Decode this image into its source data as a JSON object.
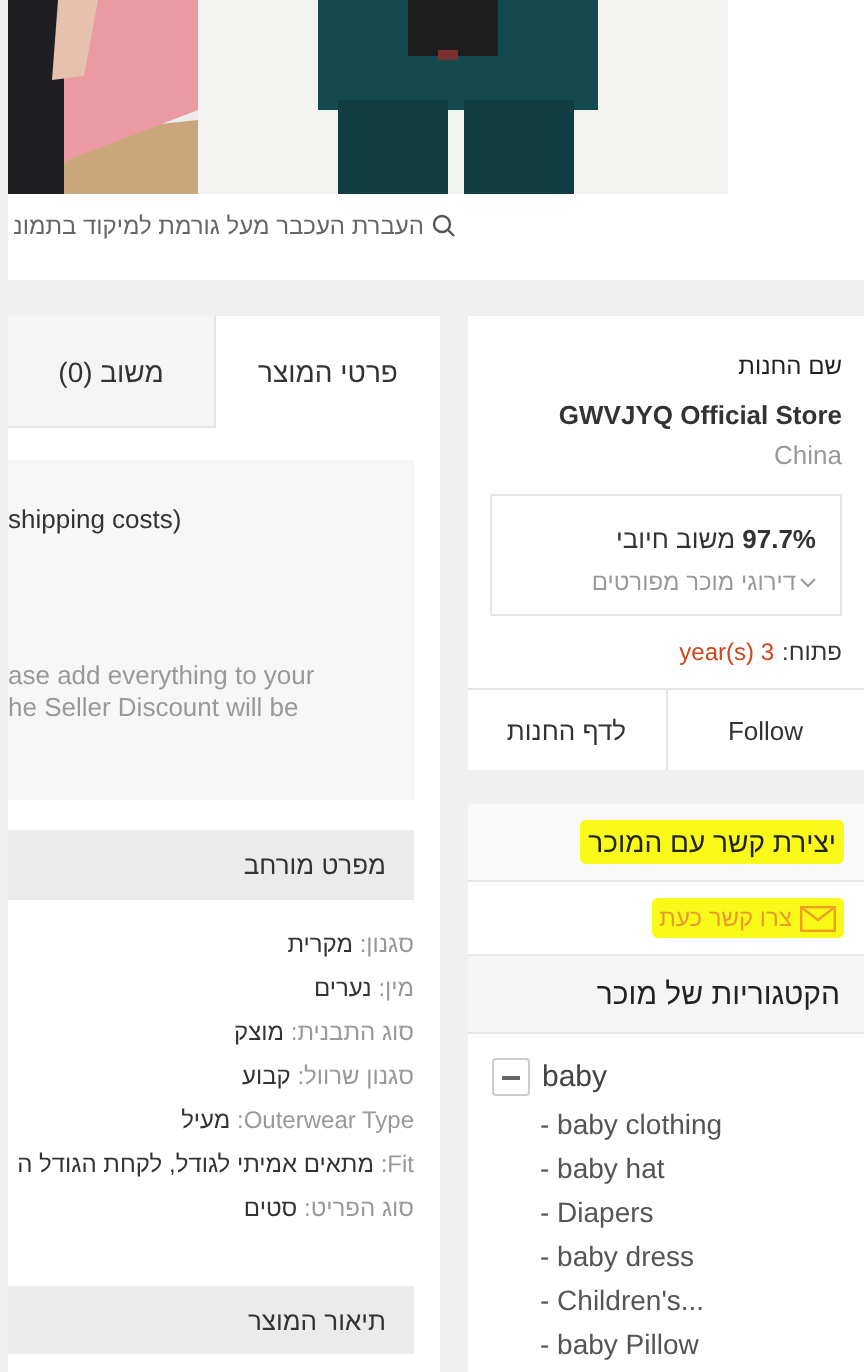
{
  "zoom_hint": "העברת העכבר מעל גורמת למיקוד בתמונ",
  "tabs": [
    {
      "label": "פרטי המוצר",
      "selected": true
    },
    {
      "label": "משוב (0)",
      "selected": false
    }
  ],
  "notice": [
    "shipping costs)",
    "ase add everything to your",
    "he Seller Discount will be"
  ],
  "specs": {
    "title": "מפרט מורחב",
    "rows": [
      {
        "label": "סגנון:",
        "value": "מקרית"
      },
      {
        "label": "מין:",
        "value": "נערים"
      },
      {
        "label": "סוג התבנית:",
        "value": "מוצק"
      },
      {
        "label": "סגנון שרוול:",
        "value": "קבוע"
      },
      {
        "label": "Outerwear Type:",
        "value": "מעיל"
      },
      {
        "label": "Fit:",
        "value": "מתאים אמיתי לגודל, לקחת הגודל ה"
      },
      {
        "label": "סוג הפריט:",
        "value": "סטים"
      }
    ]
  },
  "description_title": "תיאור המוצר",
  "store": {
    "heading": "שם החנות",
    "name": "GWVJYQ Official Store",
    "country": "China",
    "feedback": "**97.7%** משוב חיובי",
    "ratings_link": "דירוגי מוכר מפורטים",
    "open_label": "פתוח:",
    "open_value": "3 year(s)",
    "buttons": [
      "Follow",
      "לדף החנות"
    ]
  },
  "contact": {
    "title": "יצירת קשר עם המוכר",
    "link": "צרו קשר כעת"
  },
  "categories": {
    "title": "הקטגוריות של מוכר",
    "tree": [
      {
        "label": "baby",
        "expanded": true,
        "children": [
          {
            "label": "- baby clothing"
          },
          {
            "label": "- baby hat"
          },
          {
            "label": "- Diapers"
          },
          {
            "label": "- baby dress"
          },
          {
            "label": "- Children's..."
          },
          {
            "label": "- baby Pillow"
          }
        ]
      }
    ]
  }
}
